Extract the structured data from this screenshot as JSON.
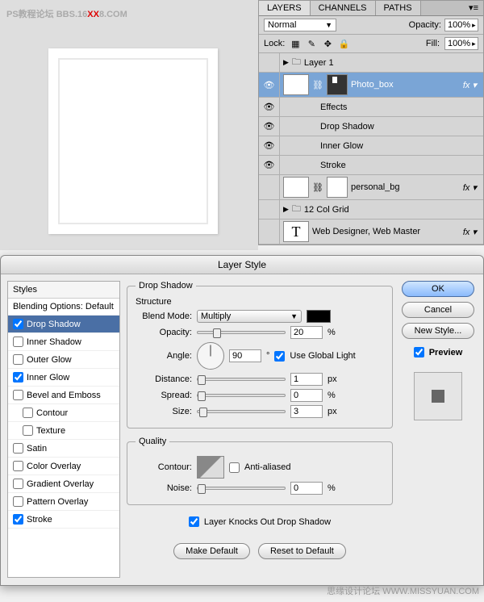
{
  "watermark": {
    "prefix": "PS教程论坛\nBBS.16",
    "red": "XX",
    "suffix": "8.COM",
    "footer": "思缘设计论坛  WWW.MISSYUAN.COM"
  },
  "layersPanel": {
    "tabs": [
      "LAYERS",
      "CHANNELS",
      "PATHS"
    ],
    "blendMode": "Normal",
    "opacityLabel": "Opacity:",
    "opacityValue": "100%",
    "lockLabel": "Lock:",
    "fillLabel": "Fill:",
    "fillValue": "100%",
    "layers": [
      {
        "name": "Layer 1",
        "type": "group"
      },
      {
        "name": "Photo_box",
        "type": "layer",
        "selected": true,
        "fx": true
      },
      {
        "name": "Effects",
        "type": "effects-header"
      },
      {
        "name": "Drop Shadow",
        "type": "effect"
      },
      {
        "name": "Inner Glow",
        "type": "effect"
      },
      {
        "name": "Stroke",
        "type": "effect"
      },
      {
        "name": "personal_bg",
        "type": "layer",
        "fx": true
      },
      {
        "name": "12 Col Grid",
        "type": "group"
      },
      {
        "name": "Web Designer, Web Master",
        "type": "text",
        "fx": true
      }
    ]
  },
  "dialog": {
    "title": "Layer Style",
    "stylesHeader": "Styles",
    "blendingOpts": "Blending Options: Default",
    "styles": [
      {
        "label": "Drop Shadow",
        "checked": true,
        "selected": true
      },
      {
        "label": "Inner Shadow",
        "checked": false
      },
      {
        "label": "Outer Glow",
        "checked": false
      },
      {
        "label": "Inner Glow",
        "checked": true
      },
      {
        "label": "Bevel and Emboss",
        "checked": false
      },
      {
        "label": "Contour",
        "checked": false,
        "indent": true
      },
      {
        "label": "Texture",
        "checked": false,
        "indent": true
      },
      {
        "label": "Satin",
        "checked": false
      },
      {
        "label": "Color Overlay",
        "checked": false
      },
      {
        "label": "Gradient Overlay",
        "checked": false
      },
      {
        "label": "Pattern Overlay",
        "checked": false
      },
      {
        "label": "Stroke",
        "checked": true
      }
    ],
    "structure": {
      "legend": "Structure",
      "section": "Drop Shadow",
      "blendModeLabel": "Blend Mode:",
      "blendMode": "Multiply",
      "opacityLabel": "Opacity:",
      "opacity": "20",
      "opacityUnit": "%",
      "angleLabel": "Angle:",
      "angle": "90",
      "angleUnit": "°",
      "globalLight": "Use Global Light",
      "distanceLabel": "Distance:",
      "distance": "1",
      "distanceUnit": "px",
      "spreadLabel": "Spread:",
      "spread": "0",
      "spreadUnit": "%",
      "sizeLabel": "Size:",
      "size": "3",
      "sizeUnit": "px"
    },
    "quality": {
      "legend": "Quality",
      "contourLabel": "Contour:",
      "antiAliased": "Anti-aliased",
      "noiseLabel": "Noise:",
      "noise": "0",
      "noiseUnit": "%"
    },
    "knockout": "Layer Knocks Out Drop Shadow",
    "makeDefault": "Make Default",
    "resetDefault": "Reset to Default",
    "buttons": {
      "ok": "OK",
      "cancel": "Cancel",
      "newStyle": "New Style...",
      "preview": "Preview"
    }
  }
}
